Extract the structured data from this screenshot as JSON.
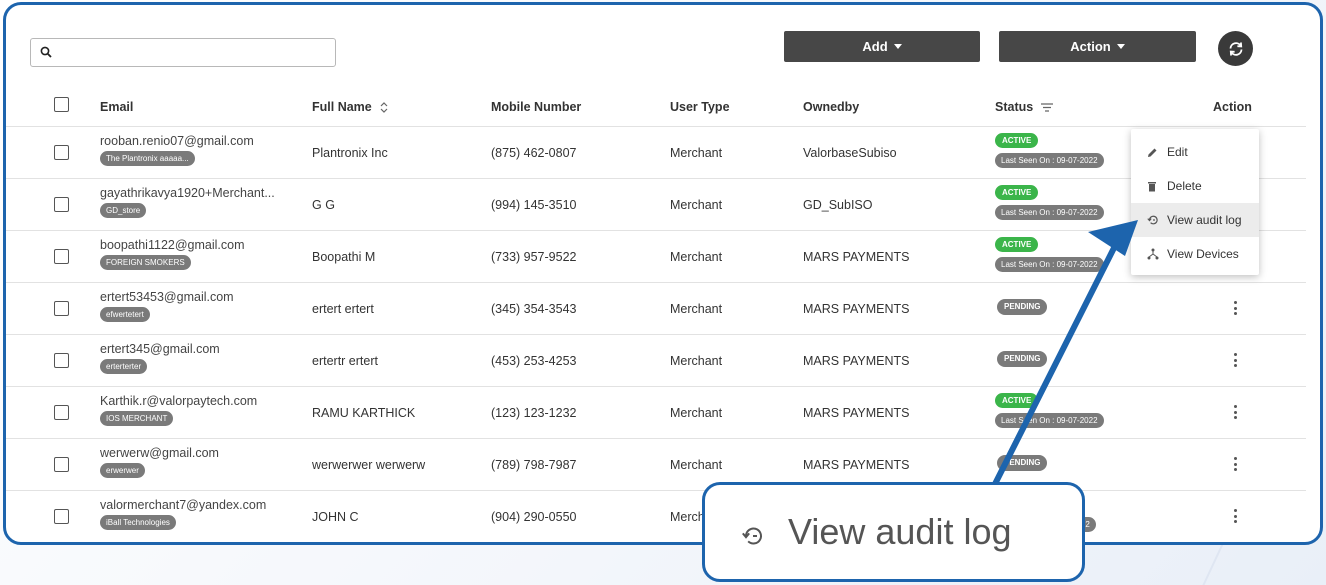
{
  "search": {
    "placeholder": "",
    "value": ""
  },
  "toolbar": {
    "add_label": "Add",
    "action_label": "Action"
  },
  "columns": {
    "email": "Email",
    "full_name": "Full Name",
    "mobile": "Mobile Number",
    "user_type": "User Type",
    "ownedby": "Ownedby",
    "status": "Status",
    "action": "Action"
  },
  "rows": [
    {
      "email": "rooban.renio07@gmail.com",
      "tag": "The Plantronix aaaaa...",
      "full_name": "Plantronix Inc",
      "mobile": "(875) 462-0807",
      "user_type": "Merchant",
      "ownedby": "ValorbaseSubiso",
      "status": "ACTIVE",
      "last_seen": "Last Seen On : 09-07-2022"
    },
    {
      "email": "gayathrikavya1920+Merchant...",
      "tag": "GD_store",
      "full_name": "G G",
      "mobile": "(994) 145-3510",
      "user_type": "Merchant",
      "ownedby": "GD_SubISO",
      "status": "ACTIVE",
      "last_seen": "Last Seen On : 09-07-2022"
    },
    {
      "email": "boopathi1122@gmail.com",
      "tag": "FOREIGN SMOKERS",
      "full_name": "Boopathi M",
      "mobile": "(733) 957-9522",
      "user_type": "Merchant",
      "ownedby": "MARS PAYMENTS",
      "status": "ACTIVE",
      "last_seen": "Last Seen On : 09-07-2022"
    },
    {
      "email": "ertert53453@gmail.com",
      "tag": "efwertetert",
      "full_name": "ertert ertert",
      "mobile": "(345) 354-3543",
      "user_type": "Merchant",
      "ownedby": "MARS PAYMENTS",
      "status": "PENDING",
      "last_seen": ""
    },
    {
      "email": "ertert345@gmail.com",
      "tag": "erterterter",
      "full_name": "ertertr ertert",
      "mobile": "(453) 253-4253",
      "user_type": "Merchant",
      "ownedby": "MARS PAYMENTS",
      "status": "PENDING",
      "last_seen": ""
    },
    {
      "email": "Karthik.r@valorpaytech.com",
      "tag": "IOS MERCHANT",
      "full_name": "RAMU KARTHICK",
      "mobile": "(123) 123-1232",
      "user_type": "Merchant",
      "ownedby": "MARS PAYMENTS",
      "status": "ACTIVE",
      "last_seen": "Last Seen On : 09-07-2022"
    },
    {
      "email": "werwerw@gmail.com",
      "tag": "erwerwer",
      "full_name": "werwerwer werwerw",
      "mobile": "(789) 798-7987",
      "user_type": "Merchant",
      "ownedby": "MARS PAYMENTS",
      "status": "PENDING",
      "last_seen": ""
    },
    {
      "email": "valormerchant7@yandex.com",
      "tag": "iBall Technologies",
      "full_name": "JOHN C",
      "mobile": "(904) 290-0550",
      "user_type": "Merchant",
      "ownedby": "",
      "status": "",
      "last_seen": ""
    }
  ],
  "action_menu": {
    "items": [
      {
        "label": "Edit",
        "icon": "pencil-icon"
      },
      {
        "label": "Delete",
        "icon": "trash-icon"
      },
      {
        "label": "View audit log",
        "icon": "history-icon"
      },
      {
        "label": "View Devices",
        "icon": "devices-icon"
      }
    ]
  },
  "callout": {
    "label": "View audit log",
    "icon": "history-icon"
  },
  "colors": {
    "frame": "#1d64ad",
    "button": "#474747",
    "active": "#3bb54a",
    "pill": "#7a7a7a"
  }
}
